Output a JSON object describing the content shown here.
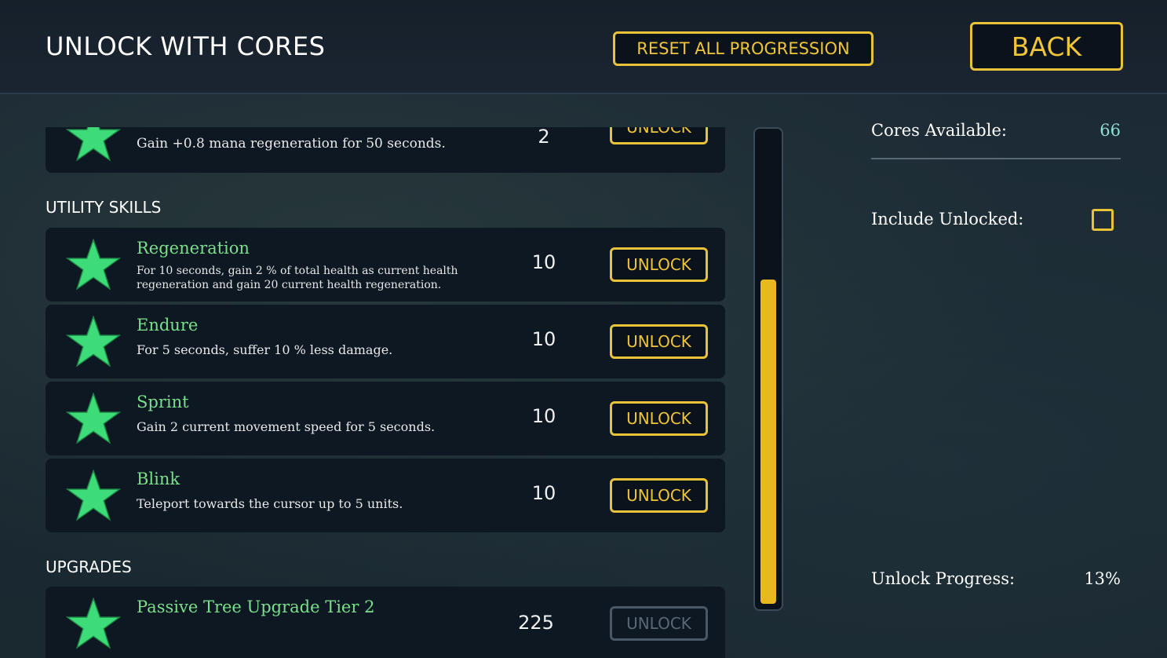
{
  "header": {
    "title": "UNLOCK WITH CORES",
    "reset_label": "RESET ALL PROGRESSION",
    "back_label": "BACK"
  },
  "colors": {
    "accent": "#e8c33a",
    "skill_name": "#7ae08c",
    "star": "#3ddc78",
    "cores_value": "#8fe0d0"
  },
  "list": {
    "partial_item": {
      "description": "Gain +0.8 mana regeneration for 50 seconds.",
      "cost": "2",
      "unlock_label": "UNLOCK",
      "icon": "star-icon"
    },
    "utility_title": "UTILITY SKILLS",
    "utility_items": [
      {
        "name": "Regeneration",
        "description": "For 10 seconds, gain 2 % of total health as current health regeneration and gain 20 current health regeneration.",
        "cost": "10",
        "unlock_label": "UNLOCK",
        "icon": "star-icon"
      },
      {
        "name": "Endure",
        "description": "For 5 seconds, suffer 10 % less damage.",
        "cost": "10",
        "unlock_label": "UNLOCK",
        "icon": "star-icon"
      },
      {
        "name": "Sprint",
        "description": "Gain 2 current movement speed for 5 seconds.",
        "cost": "10",
        "unlock_label": "UNLOCK",
        "icon": "star-icon"
      },
      {
        "name": "Blink",
        "description": "Teleport towards the cursor up to 5 units.",
        "cost": "10",
        "unlock_label": "UNLOCK",
        "icon": "star-icon"
      }
    ],
    "upgrades_title": "UPGRADES",
    "upgrade_items": [
      {
        "name": "Passive Tree Upgrade Tier 2",
        "cost": "225",
        "unlock_label": "UNLOCK",
        "disabled": true,
        "icon": "star-icon"
      }
    ]
  },
  "scroll": {
    "position_fraction": 0.31,
    "visible_fraction": 0.69
  },
  "sidebar": {
    "cores_label": "Cores Available:",
    "cores_value": "66",
    "include_unlocked_label": "Include Unlocked:",
    "include_unlocked_checked": false,
    "progress_label": "Unlock Progress:",
    "progress_value": "13%"
  }
}
